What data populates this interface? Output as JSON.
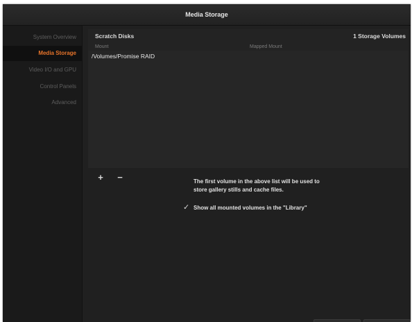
{
  "window": {
    "title": "Media Storage"
  },
  "sidebar": {
    "items": [
      {
        "label": "System Overview",
        "active": false
      },
      {
        "label": "Media Storage",
        "active": true
      },
      {
        "label": "Video I/O and GPU",
        "active": false
      },
      {
        "label": "Control Panels",
        "active": false
      },
      {
        "label": "Advanced",
        "active": false
      }
    ]
  },
  "scratch_disks": {
    "title": "Scratch Disks",
    "count_label": "1 Storage Volumes",
    "columns": [
      "Mount",
      "Mapped Mount"
    ],
    "rows": [
      {
        "mount": "/Volumes/Promise RAID",
        "mapped_mount": ""
      }
    ]
  },
  "toolbar": {
    "add_label": "+",
    "remove_label": "−"
  },
  "info_text": "The first volume in the above list will be used to store gallery stills and cache files.",
  "library_option": {
    "label": "Show all mounted volumes in the \"Library\"",
    "checked": true,
    "check_glyph": "✓"
  },
  "colors": {
    "accent": "#e8742a",
    "background": "#1c1c1c",
    "text": "#e2e2e2"
  }
}
